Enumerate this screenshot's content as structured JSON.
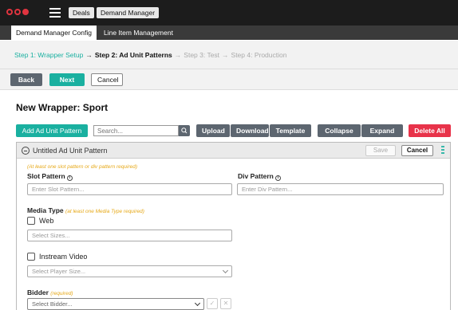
{
  "topbar": {
    "deals_label": "Deals",
    "demand_manager_label": "Demand Manager"
  },
  "tabs": [
    {
      "label": "Demand Manager Config",
      "active": true
    },
    {
      "label": "Line Item Management",
      "active": false
    }
  ],
  "steps": [
    {
      "label": "Step 1: Wrapper Setup",
      "state": "done"
    },
    {
      "label": "Step 2: Ad Unit Patterns",
      "state": "current"
    },
    {
      "label": "Step 3: Test",
      "state": "future"
    },
    {
      "label": "Step 4: Production",
      "state": "future"
    }
  ],
  "nav": {
    "back_label": "Back",
    "next_label": "Next",
    "cancel_label": "Cancel"
  },
  "page_title": "New Wrapper: Sport",
  "toolbar": {
    "add_label": "Add Ad Unit Pattern",
    "search_placeholder": "Search...",
    "upload_label": "Upload",
    "download_label": "Download",
    "template_label": "Template",
    "collapse_label": "Collapse All",
    "expand_label": "Expand All",
    "delete_label": "Delete All"
  },
  "pattern": {
    "title": "Untitled Ad Unit Pattern",
    "save_label": "Save",
    "cancel_label": "Cancel",
    "required_note": "(At least one slot pattern or div pattern required)",
    "slot_label": "Slot Pattern",
    "slot_placeholder": "Enter Slot Pattern...",
    "div_label": "Div Pattern",
    "div_placeholder": "Enter Div Pattern...",
    "media_label": "Media Type",
    "media_note": "(at least one Media Type required)",
    "web_label": "Web",
    "sizes_placeholder": "Select Sizes...",
    "instream_label": "Instream Video",
    "player_placeholder": "Select Player Size...",
    "bidder_label": "Bidder",
    "bidder_note": "(required)",
    "bidder_placeholder": "Select Bidder..."
  },
  "colors": {
    "accent_teal": "#1ab0a0",
    "danger_red": "#e8334a",
    "topbar_dark": "#1c1c1c",
    "warning_note": "#e6a817"
  }
}
